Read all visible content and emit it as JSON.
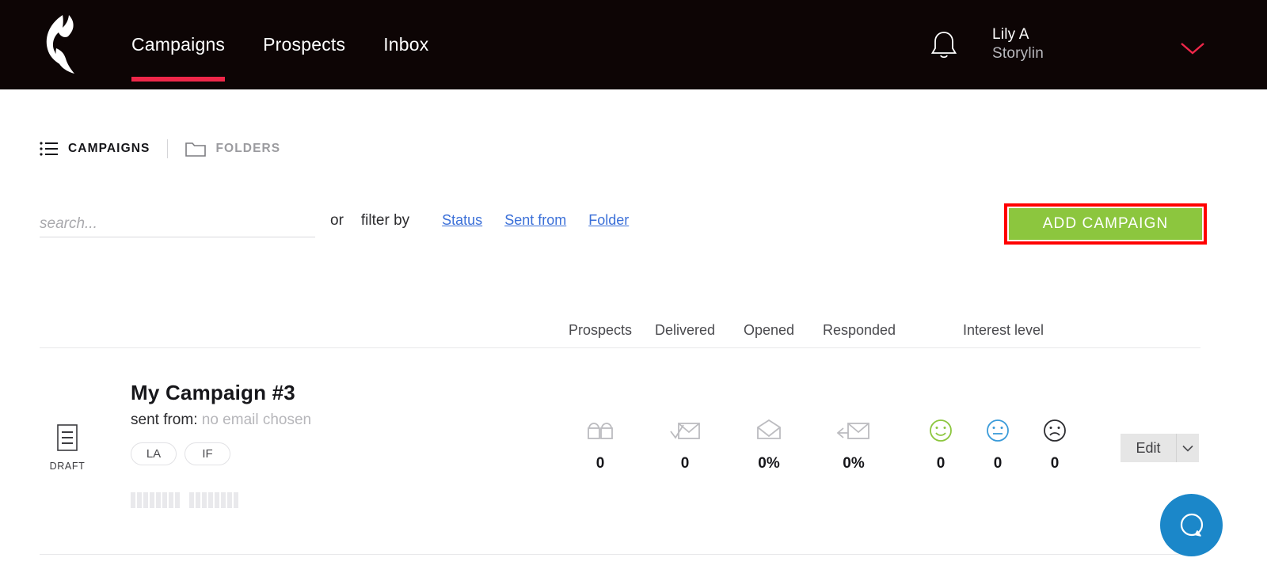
{
  "theme": {
    "header_bg": "#0d0505",
    "accent_red": "#ee2749",
    "green": "#8cc63e",
    "link_blue": "#3a6fd8",
    "chat_blue": "#1b87c9",
    "highlight_red": "#ff0000"
  },
  "header": {
    "logo_icon": "flame-bird-logo-icon",
    "nav": [
      {
        "label": "Campaigns",
        "active": true
      },
      {
        "label": "Prospects",
        "active": false
      },
      {
        "label": "Inbox",
        "active": false
      }
    ],
    "bell_icon": "bell-icon",
    "user": {
      "name": "Lily A",
      "org": "Storylin",
      "caret_icon": "chevron-down-icon"
    }
  },
  "breadcrumb": {
    "campaigns": {
      "label": "CAMPAIGNS",
      "icon": "list-icon",
      "active": true
    },
    "folders": {
      "label": "FOLDERS",
      "icon": "folder-icon",
      "active": false
    }
  },
  "search": {
    "placeholder": "search...",
    "value": ""
  },
  "filters": {
    "or_label": "or",
    "filter_by_label": "filter by",
    "links": [
      "Status",
      "Sent from",
      "Folder"
    ]
  },
  "actions": {
    "add_campaign_label": "ADD CAMPAIGN"
  },
  "table": {
    "columns": [
      "Prospects",
      "Delivered",
      "Opened",
      "Responded",
      "Interest level"
    ],
    "rows": [
      {
        "status": {
          "label": "DRAFT",
          "icon": "document-icon"
        },
        "title": "My Campaign #3",
        "sent_from_label": "sent from:",
        "sent_from_value": "no email chosen",
        "tags": [
          "LA",
          "IF"
        ],
        "metrics": [
          {
            "name": "prospects",
            "icon": "two-people-icon",
            "value": "0"
          },
          {
            "name": "delivered",
            "icon": "envelope-check-icon",
            "value": "0"
          },
          {
            "name": "opened",
            "icon": "envelope-open-icon",
            "value": "0%"
          },
          {
            "name": "responded",
            "icon": "envelope-reply-icon",
            "value": "0%"
          },
          {
            "name": "positive",
            "icon": "smiley-happy-icon",
            "value": "0"
          },
          {
            "name": "neutral",
            "icon": "smiley-neutral-icon",
            "value": "0"
          },
          {
            "name": "negative",
            "icon": "smiley-sad-icon",
            "value": "0"
          }
        ],
        "edit_label": "Edit",
        "edit_caret_icon": "chevron-down-icon"
      }
    ]
  },
  "chat": {
    "icon": "chat-bubble-icon"
  }
}
